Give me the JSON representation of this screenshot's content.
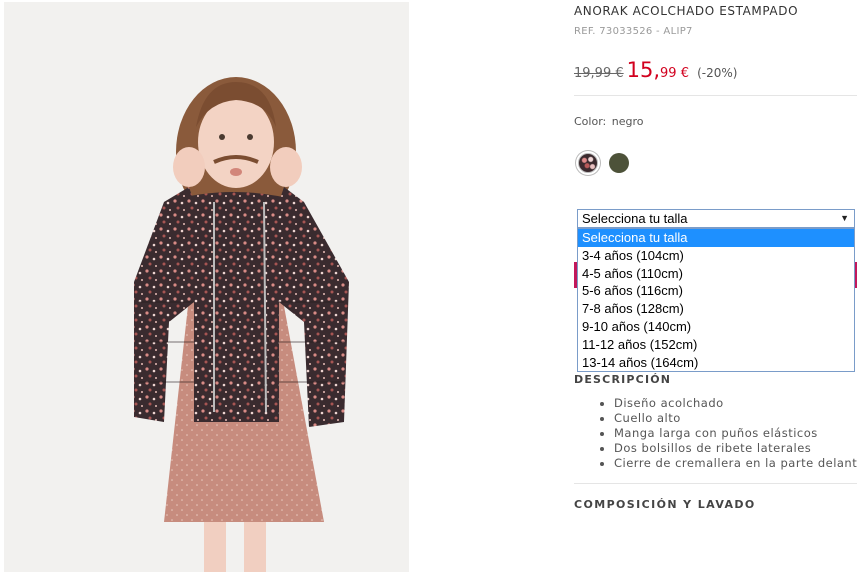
{
  "product": {
    "title": "ANORAK ACOLCHADO ESTAMPADO",
    "ref": "REF. 73033526 - ALIP7"
  },
  "price": {
    "old": "19,99 €",
    "new_int": "15,",
    "new_dec": "99 €",
    "discount": "(-20%)",
    "sale_color": "#d2001e"
  },
  "color": {
    "label": "Color:",
    "value": "negro",
    "swatches": [
      {
        "name": "floral-print",
        "hex": "#3b2a2e"
      },
      {
        "name": "olive",
        "hex": "#4d5239"
      }
    ]
  },
  "size_select": {
    "value": "Selecciona tu talla",
    "options": [
      "Selecciona tu talla",
      "3-4 años (104cm)",
      "4-5 años (110cm)",
      "5-6 años (116cm)",
      "7-8 años (128cm)",
      "9-10 años (140cm)",
      "11-12 años (152cm)",
      "13-14 años (164cm)"
    ],
    "highlight_color": "#1e90ff"
  },
  "description": {
    "title": "DESCRIPCIÓN",
    "items": [
      "Diseño acolchado",
      "Cuello alto",
      "Manga larga con puños elásticos",
      "Dos bolsillos de ribete laterales",
      "Cierre de cremallera en la parte delantera"
    ]
  },
  "composition": {
    "title": "COMPOSICIÓN Y LAVADO"
  }
}
